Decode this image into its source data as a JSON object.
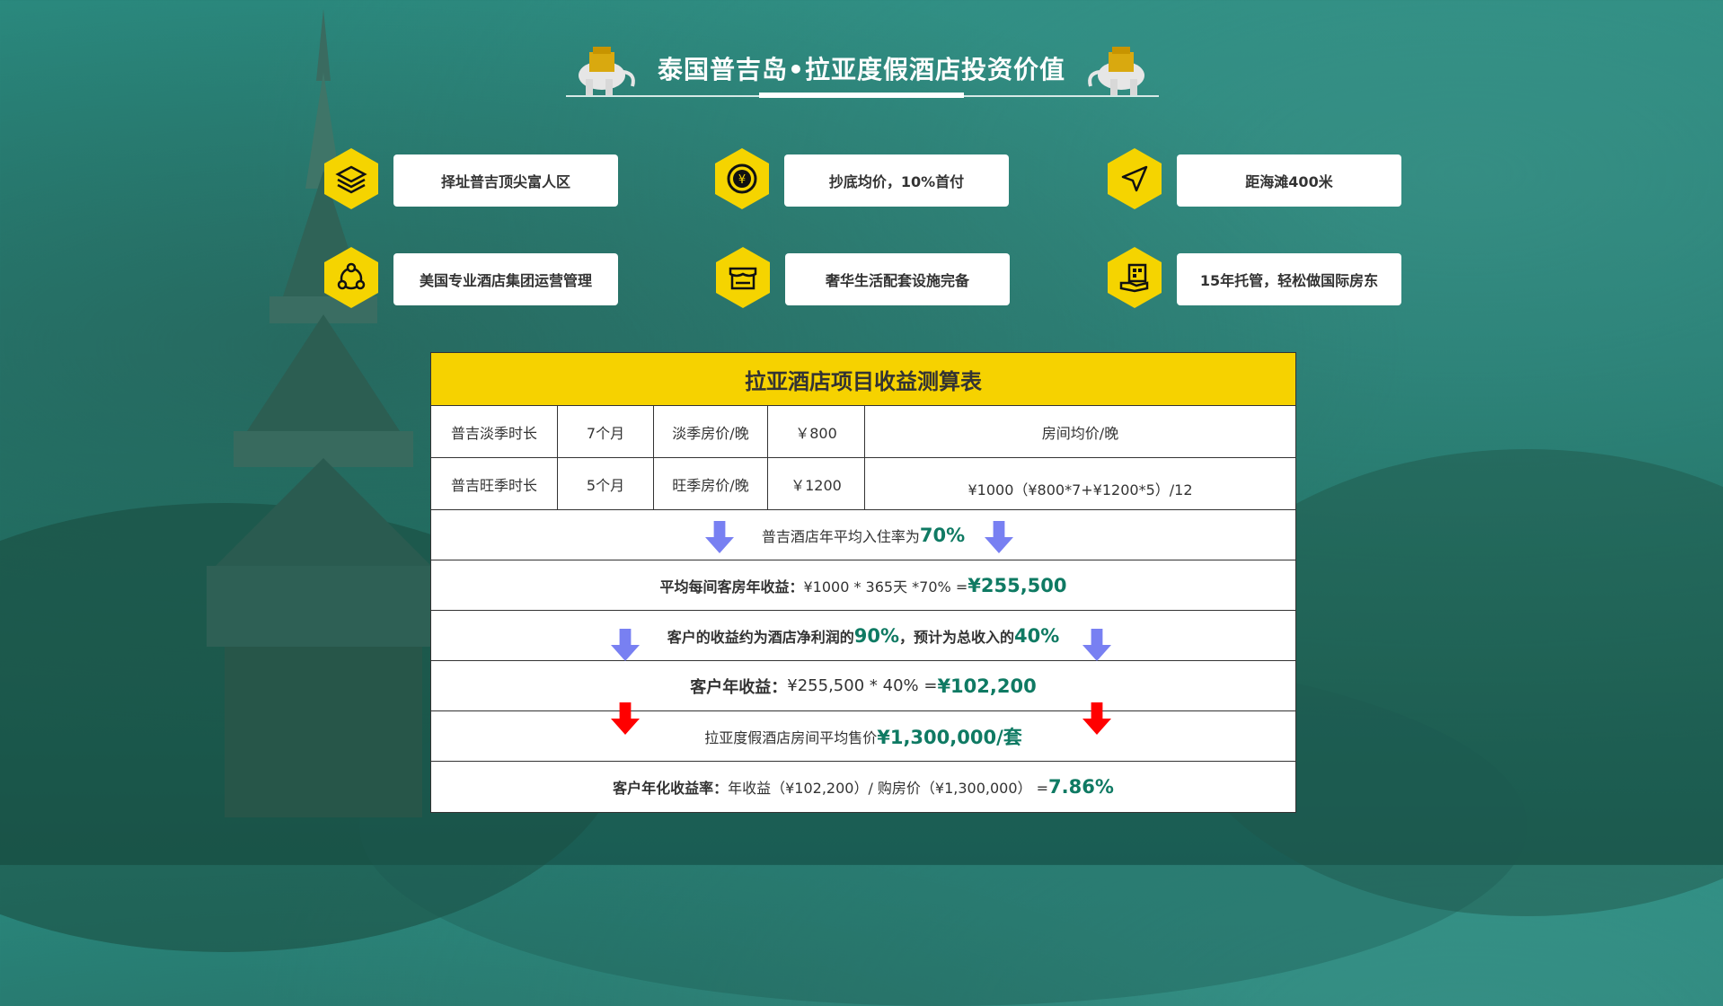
{
  "header": {
    "title": "泰国普吉岛•拉亚度假酒店投资价值"
  },
  "features": [
    {
      "label": "择址普吉顶尖富人区",
      "icon": "layers-icon"
    },
    {
      "label": "抄底均价，10%首付",
      "icon": "yen-coin-icon"
    },
    {
      "label": "距海滩400米",
      "icon": "navigation-arrow-icon"
    },
    {
      "label": "美国专业酒店集团运营管理",
      "icon": "network-icon"
    },
    {
      "label": "奢华生活配套设施完备",
      "icon": "shop-icon"
    },
    {
      "label": "15年托管，轻松做国际房东",
      "icon": "building-hand-icon"
    }
  ],
  "table": {
    "title": "拉亚酒店项目收益测算表",
    "row1": {
      "c1": "普吉淡季时长",
      "c2": "7个月",
      "c3": "淡季房价/晚",
      "c4": "￥800",
      "c5": "房间均价/晚"
    },
    "row2": {
      "c1": "普吉旺季时长",
      "c2": "5个月",
      "c3": "旺季房价/晚",
      "c4": "￥1200",
      "c5": "¥1000（¥800*7+¥1200*5）/12"
    },
    "occupancy": {
      "text": "普吉酒店年平均入住率为",
      "value": "70%"
    },
    "room_income": {
      "label": "平均每间客房年收益：",
      "formula": "¥1000 * 365天 *70% = ",
      "value": "¥255,500"
    },
    "net_profit": {
      "text1": "客户的收益约为酒店净利润的",
      "value1": "90%",
      "text2": "，预计为总收入的",
      "value2": "40%"
    },
    "client_income": {
      "label": "客户年收益：",
      "formula": "¥255,500 * 40% = ",
      "value": "¥102,200"
    },
    "price": {
      "text": "拉亚度假酒店房间平均售价",
      "value": "¥1,300,000/套"
    },
    "yield": {
      "label": "客户年化收益率：",
      "formula": "年收益（¥102,200）/ 购房价（¥1,300,000） = ",
      "value": "7.86%"
    }
  }
}
